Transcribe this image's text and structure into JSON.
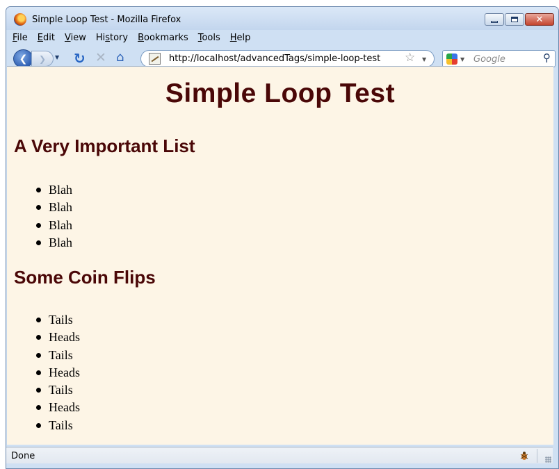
{
  "window": {
    "title": "Simple Loop Test - Mozilla Firefox"
  },
  "menu": {
    "items": [
      {
        "accel": "F",
        "rest": "ile"
      },
      {
        "accel": "E",
        "rest": "dit"
      },
      {
        "accel": "V",
        "rest": "iew"
      },
      {
        "pre": "Hi",
        "accel": "s",
        "rest": "tory"
      },
      {
        "accel": "B",
        "rest": "ookmarks"
      },
      {
        "accel": "T",
        "rest": "ools"
      },
      {
        "accel": "H",
        "rest": "elp"
      }
    ]
  },
  "navbar": {
    "url": "http://localhost/advancedTags/simple-loop-test",
    "search_placeholder": "Google"
  },
  "page": {
    "title": "Simple Loop Test",
    "section1": {
      "heading": "A Very Important List",
      "items": [
        "Blah",
        "Blah",
        "Blah",
        "Blah"
      ]
    },
    "section2": {
      "heading": "Some Coin Flips",
      "items": [
        "Tails",
        "Heads",
        "Tails",
        "Heads",
        "Tails",
        "Heads",
        "Tails"
      ]
    }
  },
  "status": {
    "text": "Done"
  },
  "colors": {
    "heading": "#4a0707",
    "page_background": "#fdf5e6"
  }
}
